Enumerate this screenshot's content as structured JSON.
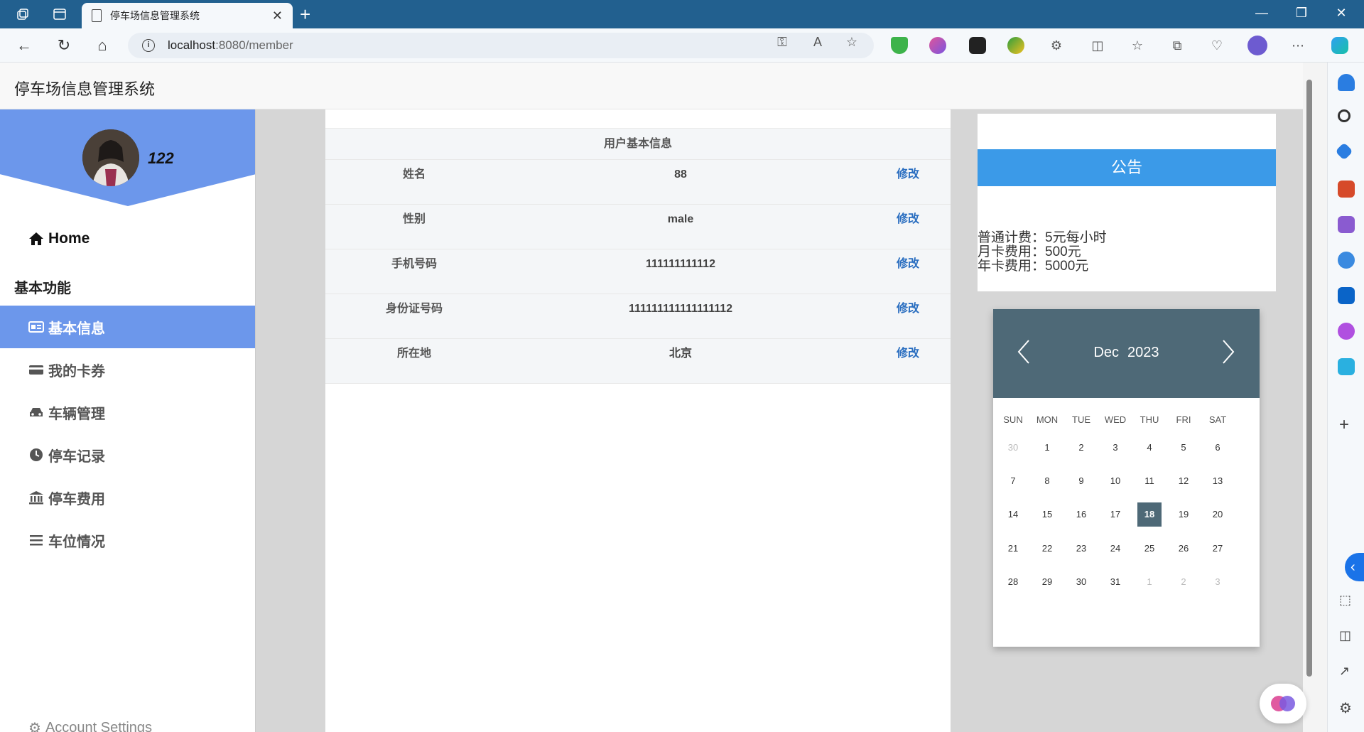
{
  "browser": {
    "tab_title": "停车场信息管理系统",
    "url_host": "localhost",
    "url_rest": ":8080/member"
  },
  "app": {
    "title": "停车场信息管理系统"
  },
  "user": {
    "name": "122"
  },
  "sidebar": {
    "home": "Home",
    "section": "基本功能",
    "items": [
      {
        "label": "基本信息",
        "icon": "id-card-icon",
        "active": true
      },
      {
        "label": "我的卡券",
        "icon": "credit-card-icon",
        "active": false
      },
      {
        "label": "车辆管理",
        "icon": "car-icon",
        "active": false
      },
      {
        "label": "停车记录",
        "icon": "clock-icon",
        "active": false
      },
      {
        "label": "停车费用",
        "icon": "bank-icon",
        "active": false
      },
      {
        "label": "车位情况",
        "icon": "list-icon",
        "active": false
      }
    ],
    "account": "Account Settings"
  },
  "info": {
    "caption": "用户基本信息",
    "rows": [
      {
        "label": "姓名",
        "value": "88",
        "action": "修改"
      },
      {
        "label": "性别",
        "value": "male",
        "action": "修改"
      },
      {
        "label": "手机号码",
        "value": "111111111112",
        "action": "修改"
      },
      {
        "label": "身份证号码",
        "value": "111111111111111112",
        "action": "修改"
      },
      {
        "label": "所在地",
        "value": "北京",
        "action": "修改"
      }
    ]
  },
  "notice": {
    "title": "公告",
    "lines": [
      "普通计费：5元每小时",
      "月卡费用：500元",
      "年卡费用：5000元"
    ]
  },
  "calendar": {
    "month": "Dec",
    "year": "2023",
    "weekdays": [
      "SUN",
      "MON",
      "TUE",
      "WED",
      "THU",
      "FRI",
      "SAT"
    ],
    "weeks": [
      [
        "30",
        "1",
        "2",
        "3",
        "4",
        "5",
        "6"
      ],
      [
        "7",
        "8",
        "9",
        "10",
        "11",
        "12",
        "13"
      ],
      [
        "14",
        "15",
        "16",
        "17",
        "18",
        "19",
        "20"
      ],
      [
        "21",
        "22",
        "23",
        "24",
        "25",
        "26",
        "27"
      ],
      [
        "28",
        "29",
        "30",
        "31",
        "1",
        "2",
        "3"
      ]
    ],
    "today": "18"
  },
  "colors": {
    "accent": "#6c97eb",
    "notice": "#3b9ae8",
    "calendar_head": "#4e6977",
    "link": "#2a6ec0"
  }
}
